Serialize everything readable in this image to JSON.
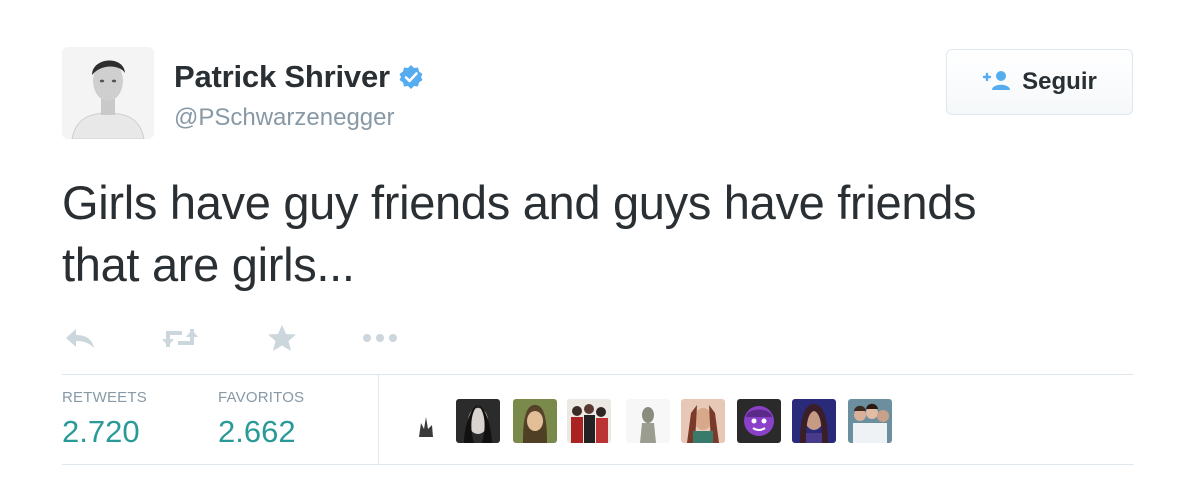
{
  "user": {
    "name": "Patrick Shriver",
    "handle": "@PSchwarzenegger",
    "verified": true
  },
  "follow_button": {
    "label": "Seguir",
    "icon": "add-user-icon"
  },
  "tweet": {
    "text_line1": "Girls have guy friends and guys have friends",
    "text_line2": "that are girls..."
  },
  "actions": [
    "reply-icon",
    "retweet-icon",
    "favorite-icon",
    "more-icon"
  ],
  "stats": {
    "retweets_label": "RETWEETS",
    "retweets_value": "2.720",
    "favorites_label": "FAVORITOS",
    "favorites_value": "2.662"
  },
  "colors": {
    "text": "#292f33",
    "muted": "#8899a6",
    "stat_value": "#2a9a98",
    "verified": "#55acee",
    "action_icon": "#ccd6dd",
    "border": "#e1e8ed"
  }
}
